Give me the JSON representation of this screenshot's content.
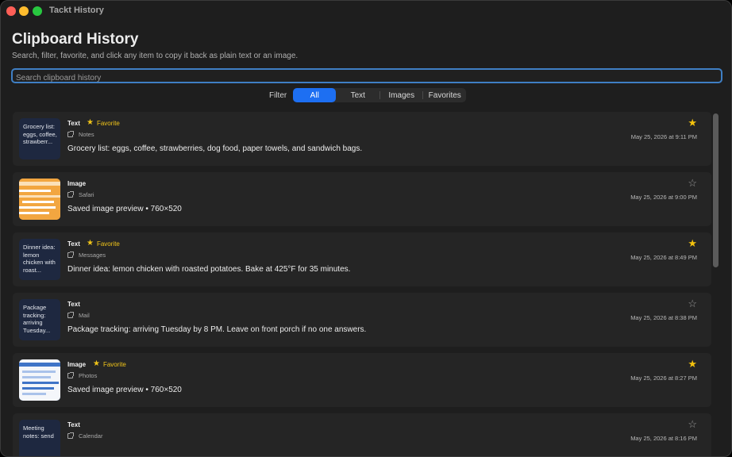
{
  "window": {
    "title": "Tackt History"
  },
  "header": {
    "title": "Clipboard History",
    "subtitle": "Search, filter, favorite, and click any item to copy it back as plain text or an image."
  },
  "search": {
    "placeholder": "Search clipboard history",
    "value": ""
  },
  "filter": {
    "label": "Filter",
    "options": [
      "All",
      "Text",
      "Images",
      "Favorites"
    ],
    "selected": "All"
  },
  "items": [
    {
      "kind": "Text",
      "favorite": true,
      "favorite_label": "Favorite",
      "source": "Notes",
      "content": "Grocery list: eggs, coffee, strawberries, dog food, paper towels, and sandwich bags.",
      "thumb_text": "Grocery list: eggs, coffee, strawberr...",
      "date": "May 25, 2026 at 9:11 PM",
      "icon": "star-filled-icon"
    },
    {
      "kind": "Image",
      "favorite": false,
      "favorite_label": "",
      "source": "Safari",
      "content": "Saved image preview • 760×520",
      "thumb_style": "orange",
      "date": "May 25, 2026 at 9:00 PM",
      "icon": "star-outline-icon"
    },
    {
      "kind": "Text",
      "favorite": true,
      "favorite_label": "Favorite",
      "source": "Messages",
      "content": "Dinner idea: lemon chicken with roasted potatoes. Bake at 425°F for 35 minutes.",
      "thumb_text": "Dinner idea: lemon chicken with roast...",
      "date": "May 25, 2026 at 8:49 PM",
      "icon": "star-filled-icon"
    },
    {
      "kind": "Text",
      "favorite": false,
      "favorite_label": "",
      "source": "Mail",
      "content": "Package tracking: arriving Tuesday by 8 PM. Leave on front porch if no one answers.",
      "thumb_text": "Package tracking: arriving Tuesday...",
      "date": "May 25, 2026 at 8:38 PM",
      "icon": "star-outline-icon"
    },
    {
      "kind": "Image",
      "favorite": true,
      "favorite_label": "Favorite",
      "source": "Photos",
      "content": "Saved image preview • 760×520",
      "thumb_style": "blue",
      "date": "May 25, 2026 at 8:27 PM",
      "icon": "star-filled-icon"
    },
    {
      "kind": "Text",
      "favorite": false,
      "favorite_label": "",
      "source": "Calendar",
      "content": "",
      "thumb_text": "Meeting notes: send",
      "date": "May 25, 2026 at 8:16 PM",
      "icon": "star-outline-icon"
    }
  ],
  "colors": {
    "accent": "#1d6ff2",
    "favorite": "#f4c20d",
    "focus_ring": "#3f7fc4",
    "thumb_orange": "#f2a640",
    "thumb_blue": "#3f74c7"
  }
}
